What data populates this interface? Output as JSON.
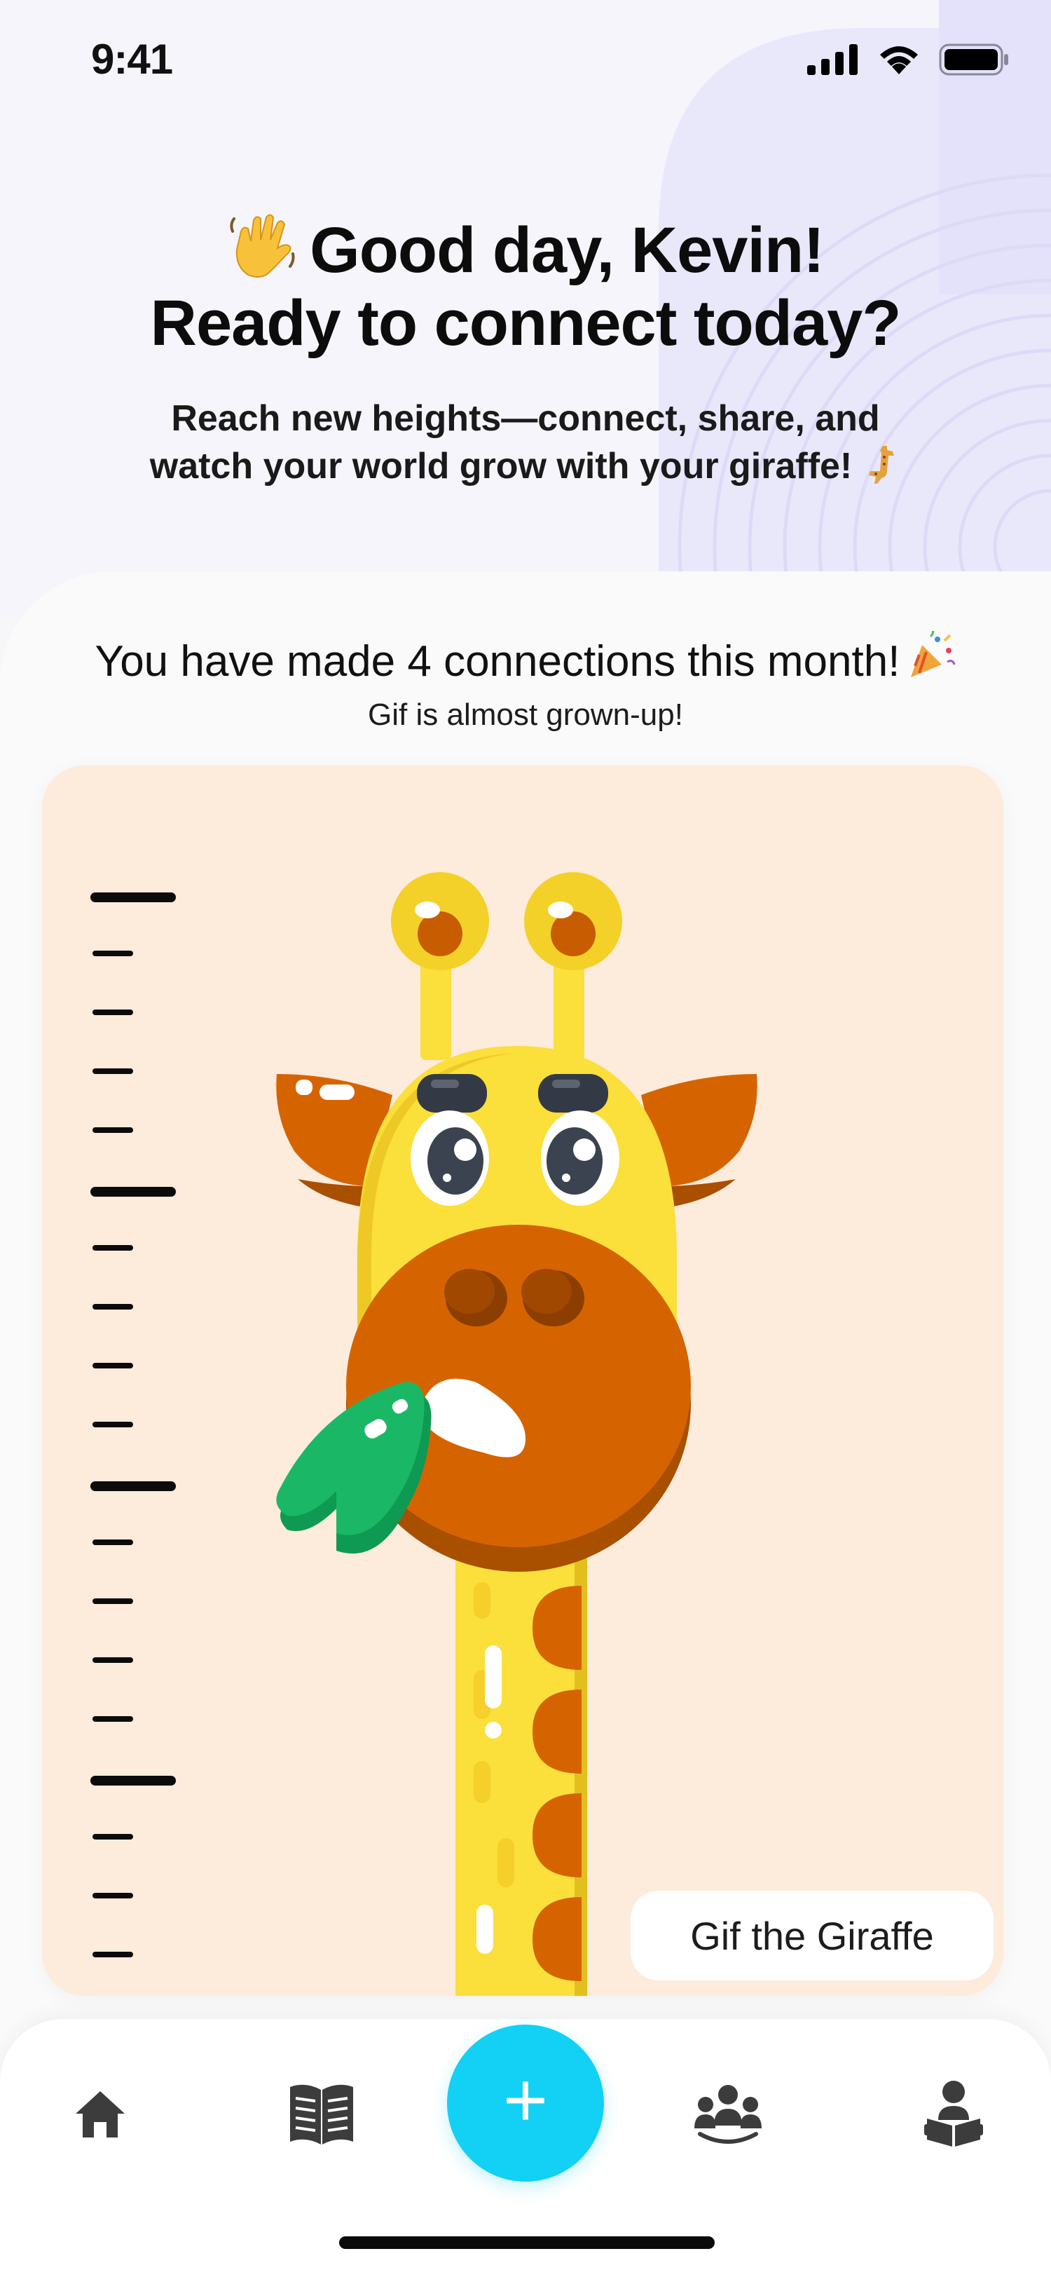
{
  "status_bar": {
    "time": "9:41"
  },
  "greeting": {
    "line1": "Good day, Kevin!",
    "line2": "Ready to connect today?",
    "tagline_line1": "Reach new heights—connect, share, and",
    "tagline_line2": "watch your world grow with your giraffe!"
  },
  "progress": {
    "title": "You have made 4 connections this month!",
    "subtitle": "Gif is almost grown-up!",
    "connections_count": 4
  },
  "mascot": {
    "name_tag": "Gif the Giraffe"
  },
  "tab_bar": {
    "items": [
      {
        "icon": "home-icon"
      },
      {
        "icon": "book-icon"
      },
      {
        "icon": "plus-icon",
        "label": "+"
      },
      {
        "icon": "group-icon"
      },
      {
        "icon": "reader-icon"
      }
    ],
    "accent": "#12d1f5"
  },
  "colors": {
    "panel_bg": "#fdebdc",
    "giraffe_yellow": "#fbdf3b",
    "giraffe_orange": "#d56400",
    "leaf_green": "#1ab866"
  }
}
